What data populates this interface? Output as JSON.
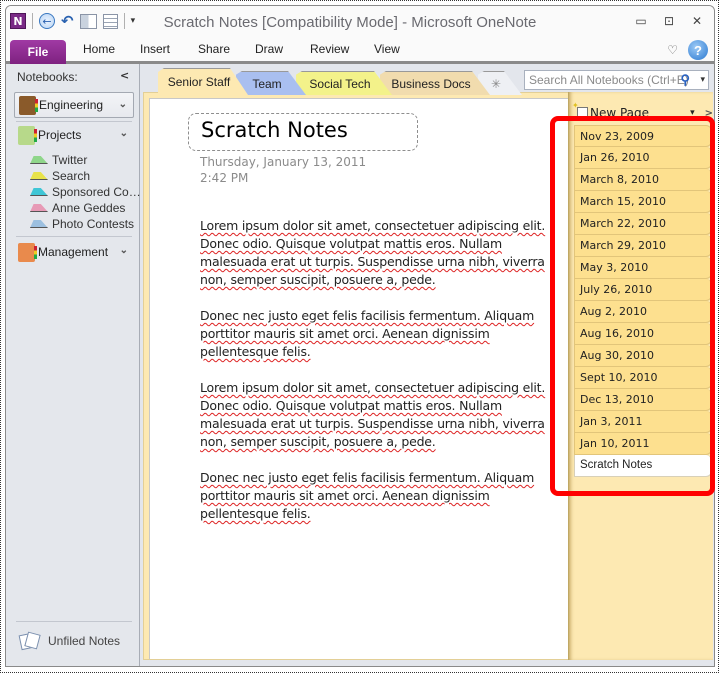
{
  "window": {
    "title": "Scratch Notes [Compatibility Mode]  -  Microsoft OneNote",
    "controls": {
      "minimize": "▭",
      "maximize": "⊡",
      "close": "✕"
    }
  },
  "quick_access": {
    "app_logo": "N",
    "back": "←",
    "undo": "↶",
    "dropdown": "▾"
  },
  "ribbon": {
    "file": "File",
    "tabs": [
      "Home",
      "Insert",
      "Share",
      "Draw",
      "Review",
      "View"
    ],
    "minimize_ribbon": "♡",
    "help": "?"
  },
  "navigation": {
    "header": "Notebooks:",
    "collapse": "<",
    "notebooks": [
      {
        "name": "Engineering",
        "selected": true,
        "color": "#8a5a2a"
      },
      {
        "name": "Projects",
        "selected": false,
        "color": "#b7d98a"
      },
      {
        "name": "Management",
        "selected": false,
        "color": "#e98a4c"
      }
    ],
    "sections": [
      {
        "name": "Twitter",
        "color": "#8fd68a"
      },
      {
        "name": "Search",
        "color": "#e8e34a"
      },
      {
        "name": "Sponsored Co…",
        "color": "#3fc6d6"
      },
      {
        "name": "Anne Geddes",
        "color": "#e79ab6"
      },
      {
        "name": "Photo Contests",
        "color": "#9cc0e0"
      }
    ],
    "unfiled": "Unfiled Notes",
    "chevron": "⌄"
  },
  "section_tabs": [
    {
      "label": "Senior Staff",
      "color": "#fde9b2",
      "active": true
    },
    {
      "label": "Team",
      "color": "#a9bff0",
      "active": false
    },
    {
      "label": "Social Tech",
      "color": "#f3f28a",
      "active": false
    },
    {
      "label": "Business Docs",
      "color": "#f1dcae",
      "active": false
    },
    {
      "label": "✳",
      "color": "#eef0f4",
      "active": false
    }
  ],
  "search": {
    "placeholder": "Search All Notebooks (Ctrl+E)",
    "icon": "⚲",
    "dropdown": "▾"
  },
  "page": {
    "title": "Scratch Notes",
    "date": "Thursday, January 13, 2011",
    "time": "2:42 PM",
    "paragraphs": [
      "Lorem ipsum dolor sit amet, consectetuer adipiscing elit. Donec odio. Quisque volutpat mattis eros. Nullam malesuada erat ut turpis. Suspendisse urna nibh, viverra non, semper suscipit, posuere a, pede.",
      "Donec nec justo eget felis facilisis  fermentum. Aliquam porttitor mauris sit amet orci.  Aenean dignissim pellentesque felis.",
      "Lorem ipsum dolor sit amet, consectetuer adipiscing elit. Donec odio. Quisque volutpat mattis eros. Nullam malesuada erat ut turpis. Suspendisse urna nibh, viverra non, semper suscipit, posuere a, pede.",
      "Donec nec justo eget felis facilisis  fermentum. Aliquam porttitor mauris sit amet orci.  Aenean dignissim pellentesque felis."
    ]
  },
  "page_tabs": {
    "new_page": "New Page",
    "dropdown": "▾",
    "expand": ">",
    "pages": [
      "Nov 23, 2009",
      "Jan 26, 2010",
      "March 8, 2010",
      "March 15, 2010",
      "March 22, 2010",
      "March 29, 2010",
      "May 3, 2010",
      "July 26, 2010",
      "Aug 2, 2010",
      "Aug 16, 2010",
      "Aug 30, 2010",
      "Sept 10, 2010",
      "Dec 13, 2010",
      "Jan 3, 2011",
      "Jan 10, 2011"
    ],
    "active_page": "Scratch Notes"
  },
  "annotation": {
    "highlight_color": "#ff0000"
  }
}
